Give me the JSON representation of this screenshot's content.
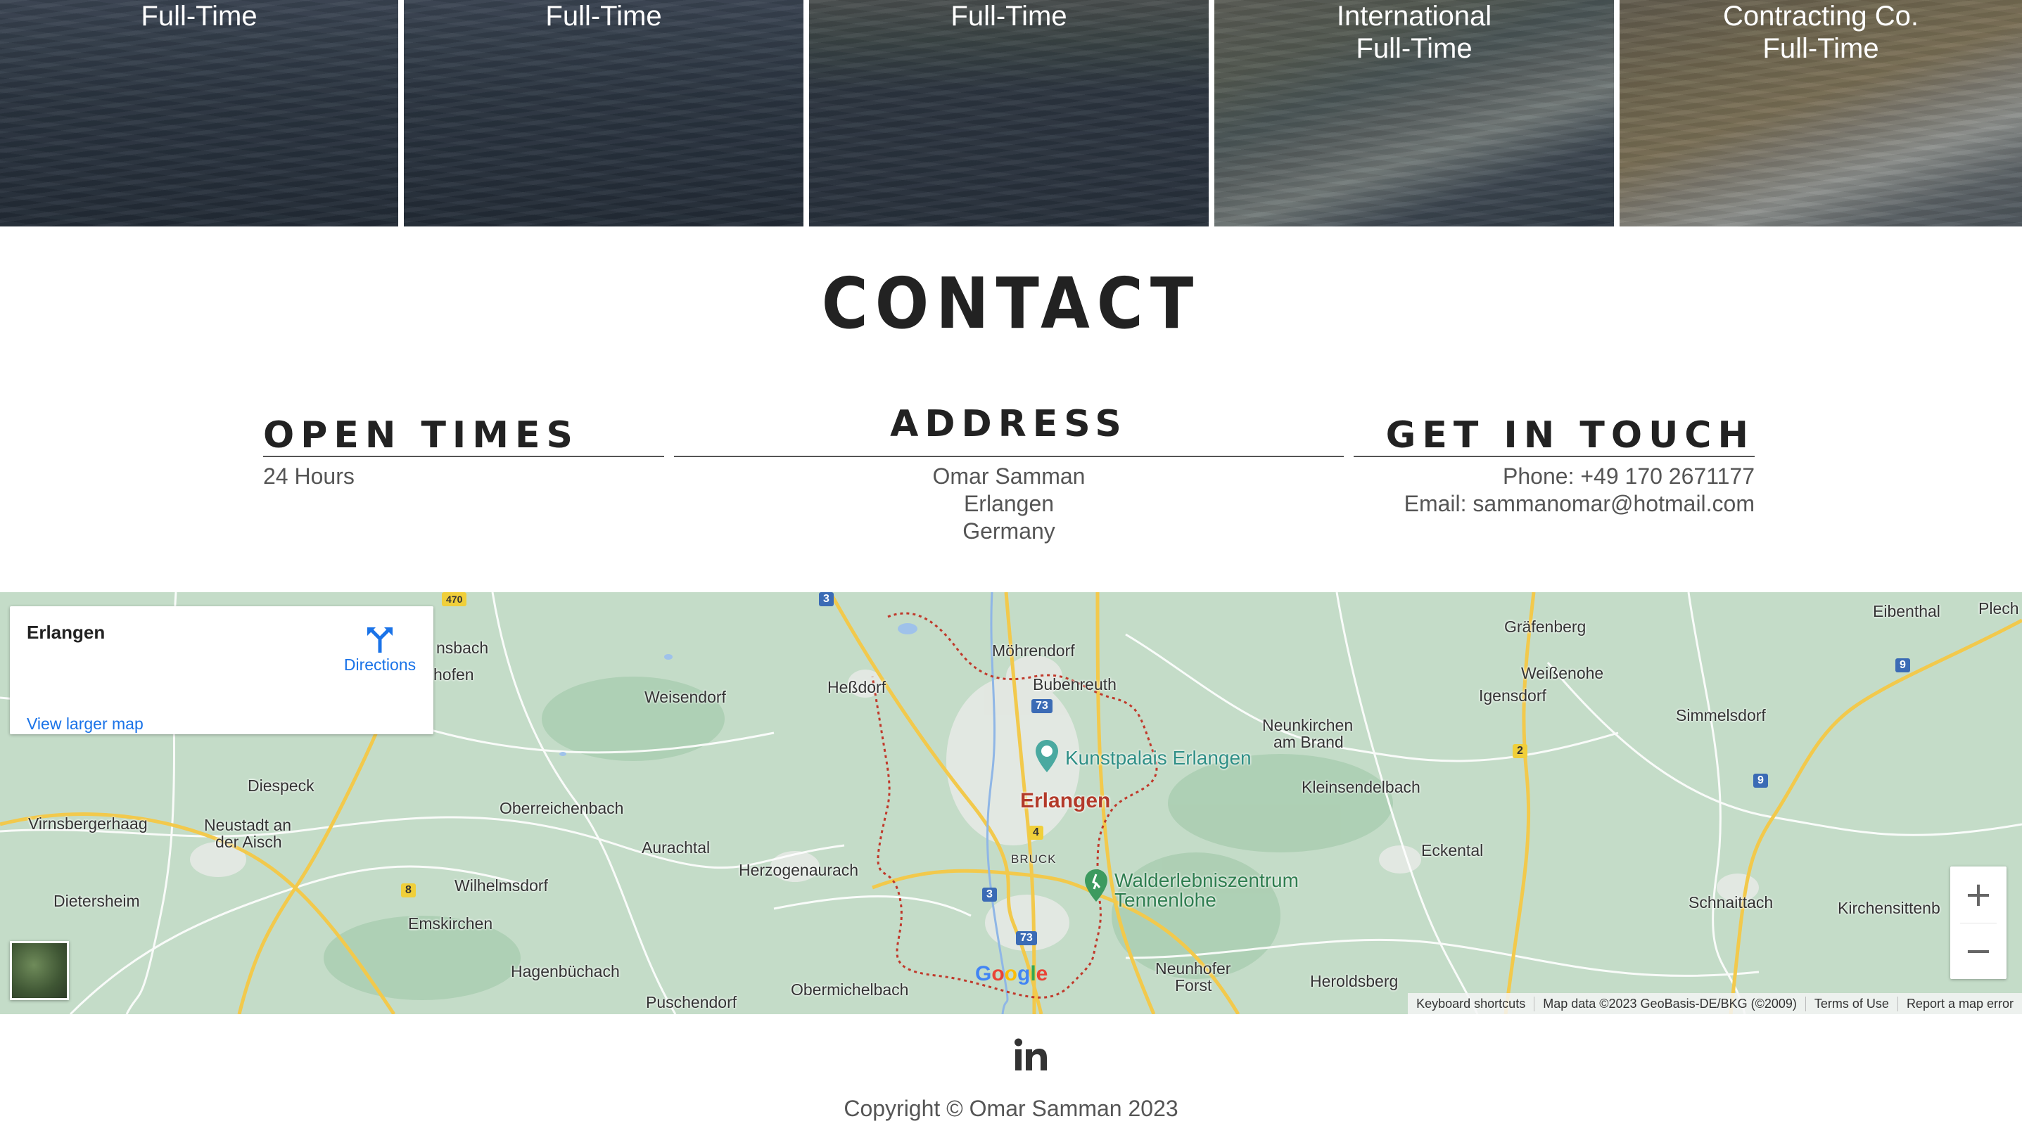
{
  "tiles": [
    {
      "lines": [
        "Full-Time"
      ]
    },
    {
      "lines": [
        "Full-Time"
      ]
    },
    {
      "lines": [
        "Full-Time"
      ]
    },
    {
      "lines": [
        "International",
        "Full-Time"
      ]
    },
    {
      "lines": [
        "Contracting Co.",
        "Full-Time"
      ]
    }
  ],
  "contact": {
    "title": "CONTACT",
    "open_times": {
      "heading": "OPEN TIMES",
      "lines": [
        "24 Hours"
      ]
    },
    "address": {
      "heading": "ADDRESS",
      "lines": [
        "Omar Samman",
        "Erlangen",
        "Germany"
      ]
    },
    "get_in_touch": {
      "heading": "GET IN TOUCH",
      "lines": [
        "Phone: +49 170 2671177",
        "Email: sammanomar@hotmail.com"
      ]
    }
  },
  "map": {
    "infobox": {
      "title": "Erlangen",
      "directions": "Directions",
      "view_larger": "View larger map"
    },
    "places": {
      "p1": "Möhrendorf",
      "p2": "Bubenreuth",
      "p3": "Heßdorf",
      "p4": "Weisendorf",
      "p5": "Gräfenberg",
      "p6": "Weißenohe",
      "p7": "Igensdorf",
      "p8": "Eibenthal",
      "p9": "Plech",
      "p10": "Simmelsdorf",
      "p11": "Neunkirchen",
      "p12": "am Brand",
      "p13": "Kunstpalais Erlangen",
      "p14": "Erlangen",
      "p15": "Kleinsendelbach",
      "p16": "Diespeck",
      "p17": "Oberreichenbach",
      "p18": "Virnsbergerhaag",
      "p19": "Neustadt an",
      "p20": "der Aisch",
      "p21": "Aurachtal",
      "p22": "Eckental",
      "p23": "BRUCK",
      "p24": "Herzogenaurach",
      "p25": "Walderlebniszentrum",
      "p26": "Tennenlohe",
      "p27": "Dietersheim",
      "p28": "Wilhelmsdorf",
      "p29": "Emskirchen",
      "p30": "Schnaittach",
      "p31": "Kirchensittenb",
      "p32": "Hagenbüchach",
      "p33": "Neunhofer",
      "p34": "Forst",
      "p35": "Heroldsberg",
      "p36": "Puschendorf",
      "p37": "Obermichelbach",
      "p38": "nsbach",
      "p39": "hofen"
    },
    "roads": {
      "r1": "3",
      "r2": "73",
      "r3": "4",
      "r4": "3",
      "r5": "73",
      "r6": "9",
      "r7": "9",
      "r8": "2",
      "r9": "8",
      "r10": "470"
    },
    "logo": "Google",
    "attribution": [
      "Keyboard shortcuts",
      "Map data ©2023 GeoBasis-DE/BKG (©2009)",
      "Terms of Use",
      "Report a map error"
    ],
    "zoom_in": "+",
    "zoom_out": "−",
    "colors": {
      "land": "#c4dcc8",
      "urban": "#e8ebe6",
      "road": "#f2c94c",
      "link": "#1a73e8",
      "boundary": "#c0392b"
    }
  },
  "footer": {
    "copyright": "Copyright © Omar Samman 2023",
    "social_icon": "linkedin-icon"
  }
}
